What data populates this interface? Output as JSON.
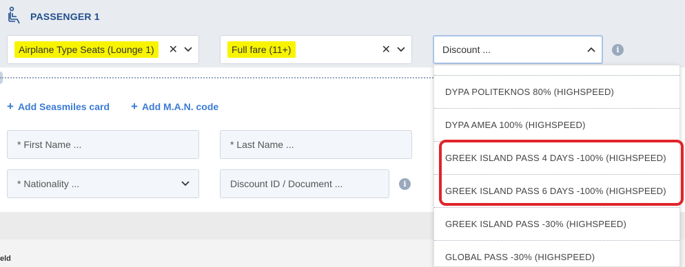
{
  "passenger": {
    "title": "PASSENGER 1"
  },
  "seat_select": {
    "value": "Airplane Type Seats (Lounge 1)"
  },
  "fare_select": {
    "value": "Full fare (11+)"
  },
  "discount_select": {
    "placeholder": "Discount ..."
  },
  "links": {
    "seasmiles": "Add Seasmiles card",
    "man_code": "Add M.A.N. code"
  },
  "fields": {
    "first_name": "* First Name ...",
    "last_name": "* Last Name ...",
    "nationality": "* Nationality ...",
    "discount_id": "Discount ID / Document ..."
  },
  "dropdown": {
    "options": [
      "DYPA POLITEKNOS 80% (HIGHSPEED)",
      "DYPA AMEA 100% (HIGHSPEED)",
      "GREEK ISLAND PASS 4 DAYS -100% (HIGHSPEED)",
      "GREEK ISLAND PASS 6 DAYS -100% (HIGHSPEED)",
      "GREEK ISLAND PASS -30% (HIGHSPEED)",
      "GLOBAL PASS -30% (HIGHSPEED)"
    ]
  },
  "icons": {
    "clear": "✕",
    "info": "i",
    "plus": "+"
  },
  "footer": {
    "label": "eld"
  },
  "colors": {
    "accent_link": "#3a7bd5",
    "title_blue": "#1f4e8c",
    "highlight": "#f8f400",
    "annotation_red": "#e0242b"
  }
}
